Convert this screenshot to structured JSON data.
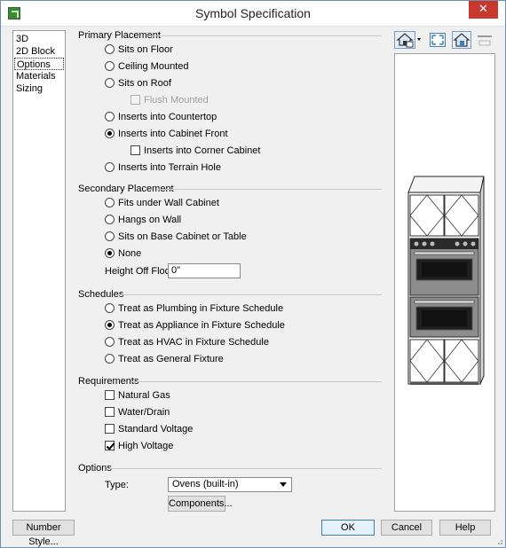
{
  "window": {
    "title": "Symbol Specification"
  },
  "nav": {
    "items": [
      "3D",
      "2D Block",
      "Options",
      "Materials",
      "Sizing"
    ],
    "selected": "Options"
  },
  "primary": {
    "title": "Primary Placement",
    "options": {
      "sits_on_floor": "Sits on Floor",
      "ceiling_mounted": "Ceiling Mounted",
      "sits_on_roof": "Sits on Roof",
      "flush_mounted": "Flush Mounted",
      "inserts_countertop": "Inserts into Countertop",
      "inserts_cabinet_front": "Inserts into Cabinet Front",
      "inserts_corner_cabinet": "Inserts into Corner Cabinet",
      "inserts_terrain_hole": "Inserts into Terrain Hole"
    },
    "selected": "inserts_cabinet_front"
  },
  "secondary": {
    "title": "Secondary Placement",
    "options": {
      "fits_under_wall": "Fits under Wall Cabinet",
      "hangs_on_wall": "Hangs on Wall",
      "sits_on_base": "Sits on Base Cabinet or Table",
      "none": "None"
    },
    "selected": "none",
    "height_label": "Height Off Floor:",
    "height_value": "0\""
  },
  "schedules": {
    "title": "Schedules",
    "options": {
      "plumbing": "Treat as Plumbing in Fixture Schedule",
      "appliance": "Treat as Appliance in Fixture Schedule",
      "hvac": "Treat as HVAC in Fixture Schedule",
      "general": "Treat as General Fixture"
    },
    "selected": "appliance"
  },
  "requirements": {
    "title": "Requirements",
    "items": {
      "natural_gas": "Natural Gas",
      "water_drain": "Water/Drain",
      "standard_voltage": "Standard Voltage",
      "high_voltage": "High Voltage"
    },
    "checked": "high_voltage"
  },
  "options": {
    "title": "Options",
    "type_label": "Type:",
    "type_value": "Ovens (built-in)",
    "components_label": "Components..."
  },
  "footer": {
    "number_style": "Number Style...",
    "ok": "OK",
    "cancel": "Cancel",
    "help": "Help"
  },
  "preview_tools": [
    "view-mode-icon",
    "fill-window-icon",
    "camera-view-icon",
    "strip-icon"
  ],
  "colors": {
    "accent_blue": "#3c7fb1",
    "close_red": "#c7392c",
    "selection_dotted": "#333333"
  }
}
